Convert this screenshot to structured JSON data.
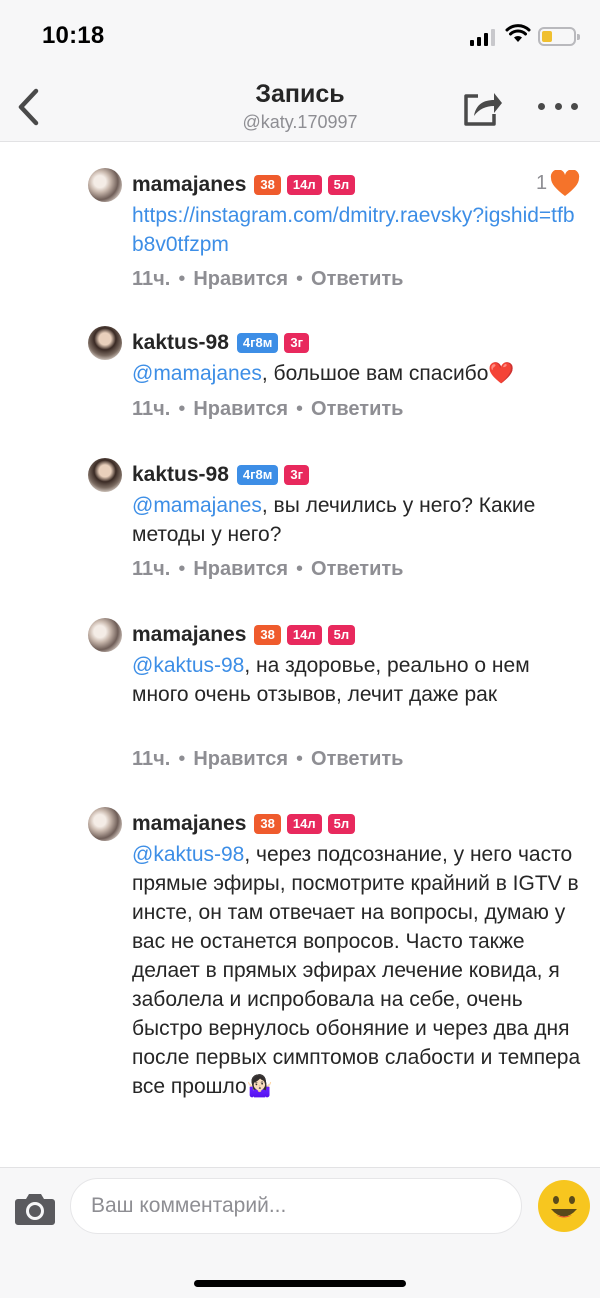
{
  "status_bar": {
    "time": "10:18",
    "battery_color": "#f0c030"
  },
  "header": {
    "title": "Запись",
    "subtitle": "@katy.170997",
    "back_icon": "chevron-left-icon",
    "share_icon": "share-icon",
    "more_icon": "more-dots-icon"
  },
  "comments": [
    {
      "username": "mamajanes",
      "badges": [
        {
          "text": "38",
          "color": "orange"
        },
        {
          "text": "14л",
          "color": "pink"
        },
        {
          "text": "5л",
          "color": "pink"
        }
      ],
      "link": "https://instagram.com/dmitry.raevsky?igshid=tfbb8v0tfzpm",
      "time": "11ч.",
      "like_label": "Нравится",
      "reply_label": "Ответить",
      "likes": "1"
    },
    {
      "username": "kaktus-98",
      "badges": [
        {
          "text": "4г8м",
          "color": "blue"
        },
        {
          "text": "3г",
          "color": "pink"
        }
      ],
      "mention": "@mamajanes",
      "text": ", большое вам спасибо❤️",
      "time": "11ч.",
      "like_label": "Нравится",
      "reply_label": "Ответить"
    },
    {
      "username": "kaktus-98",
      "badges": [
        {
          "text": "4г8м",
          "color": "blue"
        },
        {
          "text": "3г",
          "color": "pink"
        }
      ],
      "mention": "@mamajanes",
      "text": ", вы лечились у него? Какие методы у него?",
      "time": "11ч.",
      "like_label": "Нравится",
      "reply_label": "Ответить"
    },
    {
      "username": "mamajanes",
      "badges": [
        {
          "text": "38",
          "color": "orange"
        },
        {
          "text": "14л",
          "color": "pink"
        },
        {
          "text": "5л",
          "color": "pink"
        }
      ],
      "mention": "@kaktus-98",
      "text": ", на здоровье, реально о нем много очень отзывов, лечит даже рак",
      "time": "11ч.",
      "like_label": "Нравится",
      "reply_label": "Ответить"
    },
    {
      "username": "mamajanes",
      "badges": [
        {
          "text": "38",
          "color": "orange"
        },
        {
          "text": "14л",
          "color": "pink"
        },
        {
          "text": "5л",
          "color": "pink"
        }
      ],
      "mention": "@kaktus-98",
      "text": ", через подсознание, у него часто прямые эфиры, посмотрите крайний в IGTV в инсте, он там отвечает на вопросы, думаю у вас не останется вопросов. Часто также делает в прямых эфирах лечение ковида, я заболела и испробовала на себе, очень быстро вернулось обоняние и через два дня после первых симптомов слабости и темпера все прошло🤷🏻‍♀️"
    }
  ],
  "input": {
    "placeholder": "Ваш комментарий..."
  },
  "colors": {
    "accent": "#3d8ee6",
    "like": "#f5732a",
    "orange_badge": "#ef5b2d",
    "pink_badge": "#e8295d",
    "blue_badge": "#3d8ee6"
  }
}
